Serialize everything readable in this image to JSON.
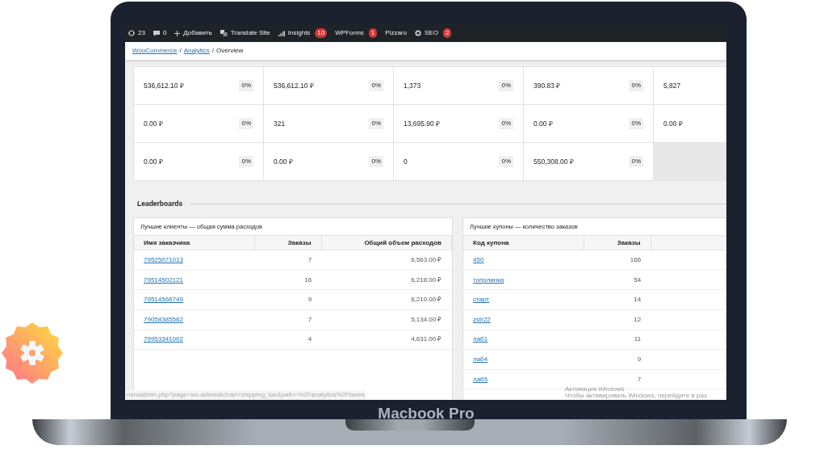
{
  "admin_bar": [
    {
      "kind": "updates",
      "text": "23"
    },
    {
      "kind": "comments",
      "text": "0"
    },
    {
      "kind": "add",
      "text": "Добавить"
    },
    {
      "kind": "translate",
      "text": "Translate Site"
    },
    {
      "kind": "insights",
      "text": "Insights",
      "badge": "10"
    },
    {
      "kind": "plain",
      "text": "WPForms",
      "badge": "1"
    },
    {
      "kind": "plain",
      "text": "Pizzaro"
    },
    {
      "kind": "seo",
      "text": "SEO",
      "badge": "2"
    }
  ],
  "breadcrumb": [
    {
      "text": "WooCommerce",
      "link": true
    },
    {
      "text": "/",
      "link": false
    },
    {
      "text": "Analytics",
      "link": true
    },
    {
      "text": "/",
      "link": false
    },
    {
      "text": "Overview",
      "link": false
    }
  ],
  "stats": [
    [
      {
        "value": "536,612.10 ₽",
        "delta": "0%"
      },
      {
        "value": "536,612.10 ₽",
        "delta": "0%"
      },
      {
        "value": "1,373",
        "delta": "0%"
      },
      {
        "value": "390.83 ₽",
        "delta": "0%"
      },
      {
        "value": "5,827"
      }
    ],
    [
      {
        "value": "0.00 ₽",
        "delta": "0%"
      },
      {
        "value": "321",
        "delta": "0%"
      },
      {
        "value": "13,695.90 ₽",
        "delta": "0%"
      },
      {
        "value": "0.00 ₽",
        "delta": "0%"
      },
      {
        "value": "0.00 ₽"
      }
    ],
    [
      {
        "value": "0.00 ₽",
        "delta": "0%"
      },
      {
        "value": "0.00 ₽",
        "delta": "0%"
      },
      {
        "value": "0",
        "delta": "0%"
      },
      {
        "value": "550,308.00 ₽",
        "delta": "0%"
      }
    ]
  ],
  "leaderboards": {
    "title": "Leaderboards",
    "tables": [
      {
        "title": "Лучшие клиенты — общая сумма расходов",
        "columns": [
          "Имя заказчика",
          "Заказы",
          "Общий объем расходов"
        ],
        "rows": [
          [
            "79525071013",
            "7",
            "6,563.00 ₽"
          ],
          [
            "79514502121",
            "16",
            "6,218.00 ₽"
          ],
          [
            "79514566749",
            "9",
            "6,210.00 ₽"
          ],
          [
            "79058385562",
            "7",
            "5,134.00 ₽"
          ],
          [
            "79953341002",
            "4",
            "4,631.00 ₽"
          ]
        ]
      },
      {
        "title": "Лучшие купоны — количество заказов",
        "columns": [
          "Код купона",
          "Заказы"
        ],
        "rows": [
          [
            "450",
            "166"
          ],
          [
            "тополинка",
            "54"
          ],
          [
            "старт",
            "14"
          ],
          [
            "zstr22",
            "12"
          ],
          [
            "лаб1",
            "11"
          ],
          [
            "лаб4",
            "9"
          ],
          [
            "лаб5",
            "7"
          ]
        ]
      }
    ]
  },
  "status_url": "min/admin.php?page=wc-admin&chart=shipping_tax&path=%2Fanalytics%2Ftaxes",
  "os_notice": {
    "title": "Активация Windows",
    "text": "Чтобы активировать Windows, перейдите в раз"
  },
  "device_label": "Macbook Pro"
}
